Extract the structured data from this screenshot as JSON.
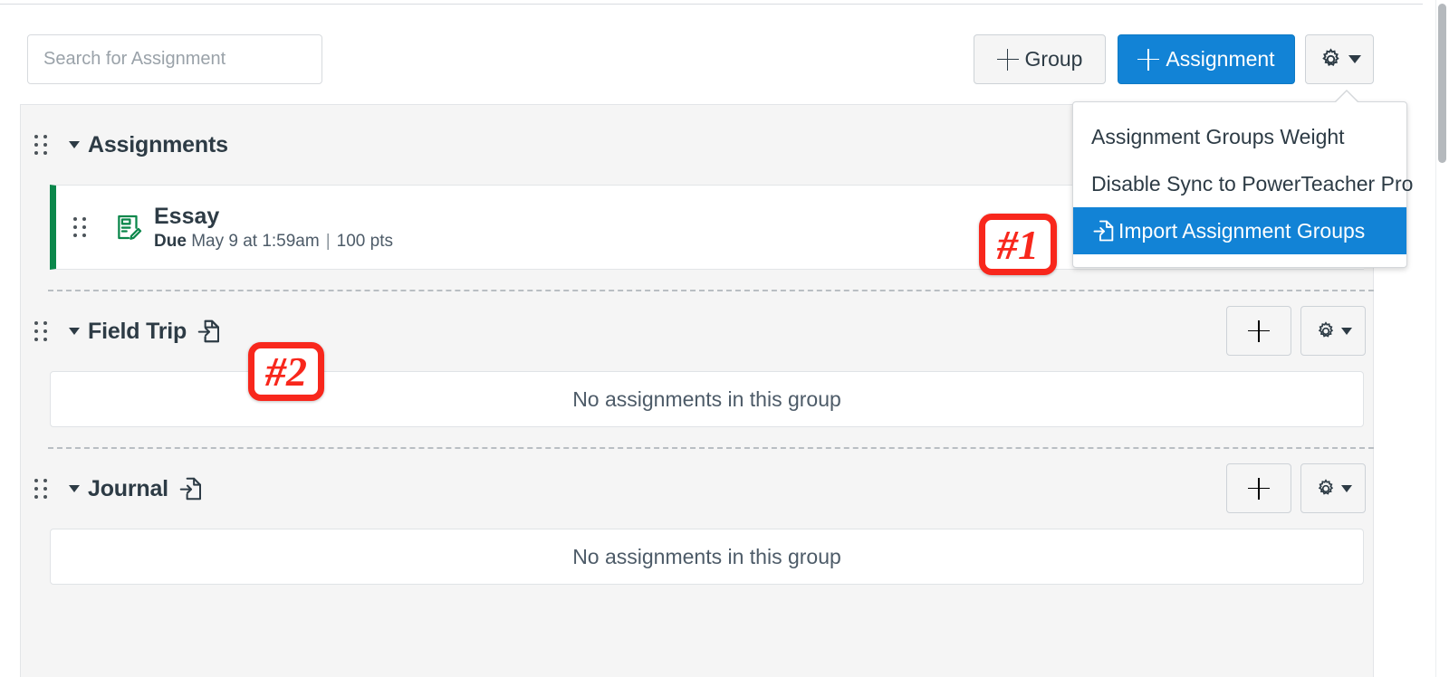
{
  "search": {
    "placeholder": "Search for Assignment",
    "value": ""
  },
  "toolbar": {
    "group_button_label": "Group",
    "assignment_button_label": "Assignment",
    "gear_button_label": "",
    "accent_color": "#1283d6"
  },
  "menu": {
    "items": [
      {
        "label": "Assignment Groups Weight",
        "icon": "",
        "selected": false
      },
      {
        "label": "Disable Sync to PowerTeacher Pro",
        "icon": "",
        "selected": false
      },
      {
        "label": "Import Assignment Groups",
        "icon": "import-icon",
        "selected": true
      }
    ]
  },
  "groups": [
    {
      "name": "Assignments",
      "has_import_icon": false,
      "empty_message": "",
      "assignments": [
        {
          "title": "Essay",
          "due_label": "Due",
          "due_value": "May 9 at 1:59am",
          "separator": "|",
          "points": "100 pts",
          "status_color": "#0b874b",
          "icon": "assignment-icon"
        }
      ]
    },
    {
      "name": "Field Trip",
      "has_import_icon": true,
      "empty_message": "No assignments in this group",
      "assignments": []
    },
    {
      "name": "Journal",
      "has_import_icon": true,
      "empty_message": "No assignments in this group",
      "assignments": []
    }
  ],
  "annotations": [
    {
      "id": "callout-1",
      "label": "#1",
      "color": "#f8271c"
    },
    {
      "id": "callout-2",
      "label": "#2",
      "color": "#f8271c"
    }
  ]
}
